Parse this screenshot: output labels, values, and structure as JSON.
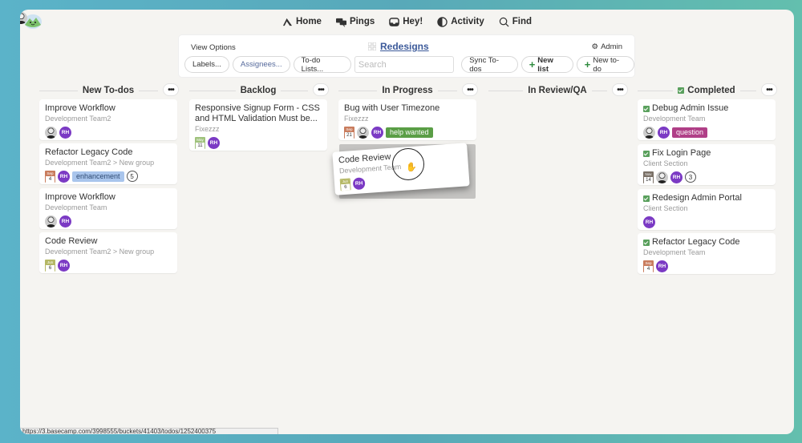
{
  "topnav": {
    "items": [
      {
        "label": "Home",
        "icon": "home-icon"
      },
      {
        "label": "Pings",
        "icon": "chat-bubbles-icon"
      },
      {
        "label": "Hey!",
        "icon": "inbox-icon"
      },
      {
        "label": "Activity",
        "icon": "activity-icon"
      },
      {
        "label": "Find",
        "icon": "search-icon"
      }
    ]
  },
  "toolbar": {
    "view_options": "View Options",
    "project_title": "Redesigns",
    "admin": "Admin",
    "buttons": {
      "labels": "Labels...",
      "assignees": "Assignees...",
      "todo_lists": "To-do Lists...",
      "search_placeholder": "Search",
      "sync": "Sync To-dos",
      "new_list": "New list",
      "new_todo": "New to-do"
    }
  },
  "colors": {
    "accent_link": "#3c5a9a",
    "rh_avatar": "#7b3ac4",
    "tag_enhancement": "#a9c5ec",
    "tag_help_wanted": "#5a9e46",
    "tag_question": "#b03f87",
    "check_green": "#5aa05d"
  },
  "columns": [
    {
      "name": "New To-dos",
      "cards": [
        {
          "title": "Improve Workflow",
          "sub": "Development Team2",
          "assignees": [
            "photo",
            "RH"
          ]
        },
        {
          "title": "Refactor Legacy Code",
          "sub": "Development Team2 > New group",
          "date": {
            "month": "Sep",
            "day": "4"
          },
          "assignees": [
            "RH"
          ],
          "tag": "enhancement",
          "count": "5"
        },
        {
          "title": "Improve Workflow",
          "sub": "Development Team",
          "assignees": [
            "photo",
            "RH"
          ]
        },
        {
          "title": "Code Review",
          "sub": "Development Team2 > New group",
          "date": {
            "month": "Jun",
            "day": "6"
          },
          "assignees": [
            "RH"
          ]
        }
      ]
    },
    {
      "name": "Backlog",
      "cards": [
        {
          "title": "Responsive Signup Form - CSS and HTML Validation Must be...",
          "sub": "Fixezzz",
          "date": {
            "month": "May",
            "day": "11"
          },
          "assignees": [
            "RH"
          ]
        }
      ]
    },
    {
      "name": "In Progress",
      "cards": [
        {
          "title": "Bug with User Timezone",
          "sub": "Fixezzz",
          "date": {
            "month": "Sep",
            "day": "21"
          },
          "assignees": [
            "photo",
            "RH"
          ],
          "tag": "help wanted"
        }
      ]
    },
    {
      "name": "In Review/QA",
      "cards": []
    },
    {
      "name": "Completed",
      "cards": [
        {
          "title": "Debug Admin Issue",
          "sub": "Development Team",
          "assignees": [
            "photo",
            "RH"
          ],
          "tag": "question"
        },
        {
          "title": "Fix Login Page",
          "sub": "Client Section",
          "date": {
            "month": "Nov",
            "day": "14"
          },
          "assignees": [
            "photo",
            "RH"
          ],
          "count": "3"
        },
        {
          "title": "Redesign Admin Portal",
          "sub": "Client Section",
          "assignees": [
            "RH"
          ]
        },
        {
          "title": "Refactor Legacy Code",
          "sub": "Development Team",
          "date": {
            "month": "Sep",
            "day": "4"
          },
          "assignees": [
            "RH"
          ]
        }
      ]
    }
  ],
  "dragging_card": {
    "title": "Code Review",
    "sub": "Development Team",
    "date": {
      "month": "Jun",
      "day": "6"
    },
    "assignee": "RH"
  },
  "statusbar": {
    "url": "https://3.basecamp.com/3998555/buckets/41403/todos/1252400375"
  }
}
